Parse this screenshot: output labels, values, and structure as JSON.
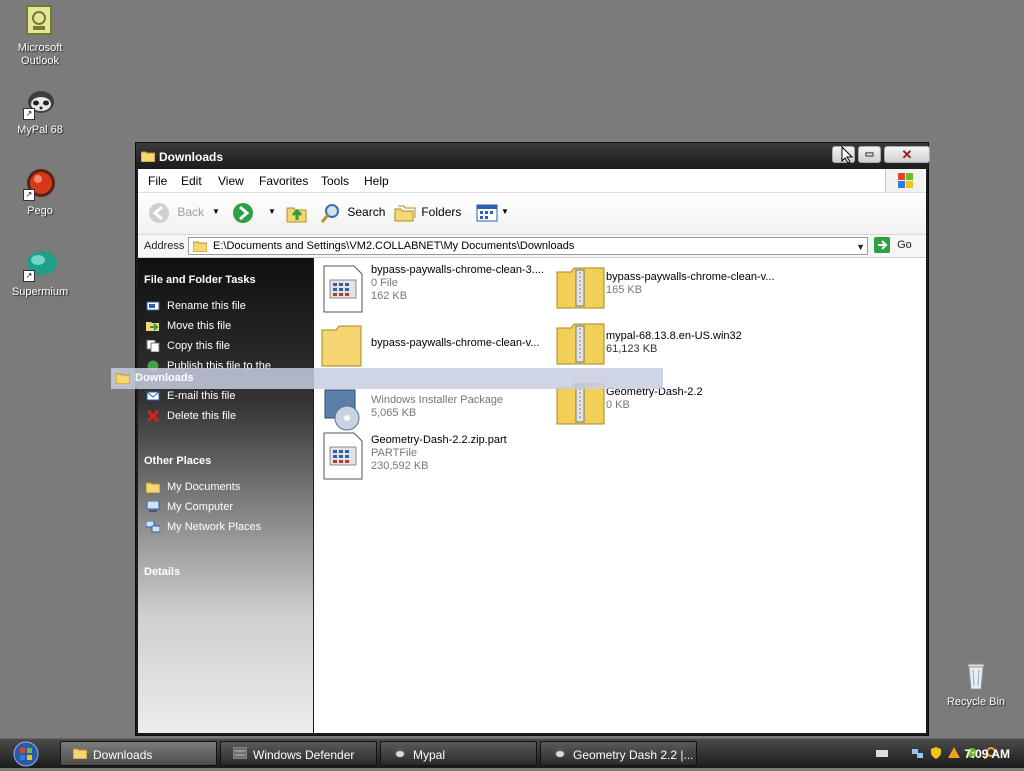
{
  "desktop": {
    "icons": [
      {
        "label_line1": "Microsoft",
        "label_line2": "Outlook"
      },
      {
        "label_line1": "MyPal 68",
        "label_line2": ""
      },
      {
        "label_line1": "Pego",
        "label_line2": ""
      },
      {
        "label_line1": "Supermium",
        "label_line2": ""
      },
      {
        "label_line1": "Recycle Bin",
        "label_line2": ""
      }
    ]
  },
  "window": {
    "title": "Downloads",
    "menu": [
      "File",
      "Edit",
      "View",
      "Favorites",
      "Tools",
      "Help"
    ],
    "toolbar": {
      "back": "Back",
      "search": "Search",
      "folders": "Folders"
    },
    "address": {
      "label": "Address",
      "value": "E:\\Documents and Settings\\VM2.COLLABNET\\My Documents\\Downloads",
      "go": "Go"
    },
    "tasks": {
      "file_folder_heading": "File and Folder Tasks",
      "file_folder_items": [
        "Rename this file",
        "Move this file",
        "Copy this file",
        "Publish this file to the",
        "E-mail this file",
        "Delete this file"
      ],
      "other_places_heading": "Other Places",
      "other_places_items": [
        "My Documents",
        "My Computer",
        "My Network Places"
      ],
      "details_heading": "Details"
    },
    "files": [
      {
        "name": "bypass-paywalls-chrome-clean-3....",
        "type": "0 File",
        "size": "162 KB"
      },
      {
        "name": "bypass-paywalls-chrome-clean-v...",
        "type": "",
        "size": "165 KB"
      },
      {
        "name": "bypass-paywalls-chrome-clean-v...",
        "type": "",
        "size": ""
      },
      {
        "name": "mypal-68.13.8.en-US.win32",
        "type": "",
        "size": "61,123 KB"
      },
      {
        "name": "",
        "type": "Windows Installer Package",
        "size": "5,065 KB"
      },
      {
        "name": "Geometry-Dash-2.2",
        "type": "",
        "size": "0 KB"
      },
      {
        "name": "Geometry-Dash-2.2.zip.part",
        "type": "PARTFile",
        "size": "230,592 KB"
      }
    ],
    "drag_label": "Downloads"
  },
  "taskbar": {
    "buttons": [
      "Downloads",
      "Windows Defender",
      "Mypal",
      "Geometry Dash 2.2 |..."
    ],
    "clock": "7:09 AM"
  },
  "colors": {
    "desktop": "#7b7b7b",
    "window_frame": "#1b1b1b",
    "go_green": "#2ea043"
  }
}
